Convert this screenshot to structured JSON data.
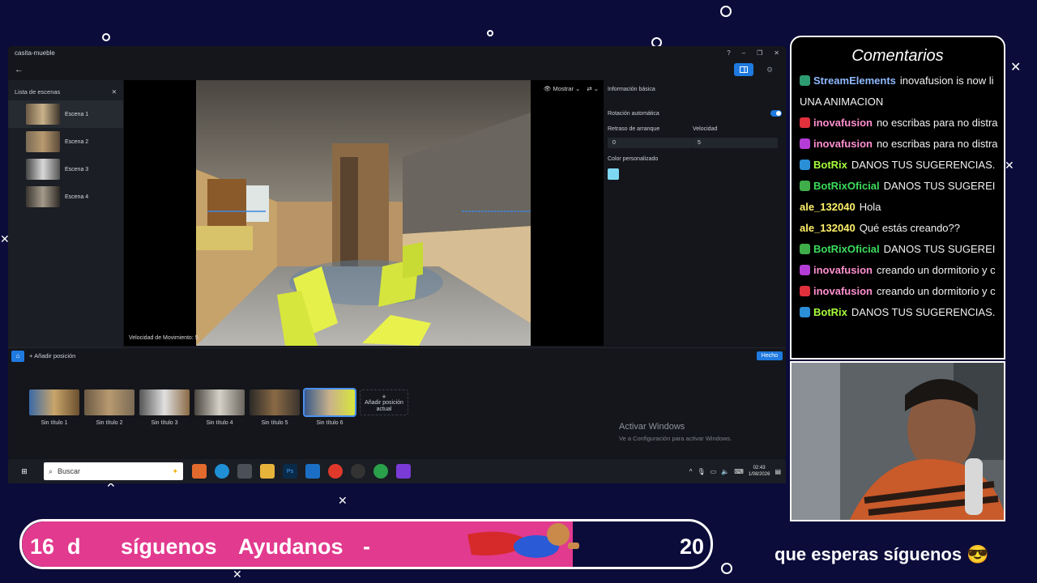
{
  "app": {
    "title": "casita-mueble",
    "window_controls": [
      "?",
      "–",
      "❐",
      "✕"
    ],
    "scene_panel": {
      "title": "Lista de escenas",
      "scenes": [
        {
          "label": "Escena 1"
        },
        {
          "label": "Escena 2"
        },
        {
          "label": "Escena 3"
        },
        {
          "label": "Escena 4"
        }
      ]
    },
    "viewport": {
      "speed_label": "Velocidad de Movimiento: 5",
      "show_label": "Mostrar"
    },
    "props": {
      "basic_info": "Información básica",
      "auto_rotation": "Rotación automática",
      "start_delay_label": "Retraso de arranque",
      "start_delay_value": "0",
      "speed_label": "Velocidad",
      "speed_value": "5",
      "custom_color": "Color personalizado",
      "color": "#7fd8f2"
    },
    "position_bar": {
      "add_label": "Añadir posición",
      "done_label": "Hecho"
    },
    "positions": [
      {
        "label": "Sin título 1"
      },
      {
        "label": "Sin título 2"
      },
      {
        "label": "Sin título 3"
      },
      {
        "label": "Sin título 4"
      },
      {
        "label": "Sin título 5"
      },
      {
        "label": "Sin título 6"
      }
    ],
    "add_current_label": "Añadir posición actual",
    "watermark": {
      "title": "Activar Windows",
      "subtitle": "Ve a Configuración para activar Windows."
    }
  },
  "taskbar": {
    "search_placeholder": "Buscar",
    "time": "02:43",
    "date": "1/08/2026"
  },
  "chat": {
    "title": "Comentarios",
    "messages": [
      {
        "user": "StreamElements",
        "text": "inovafusion is now li",
        "color": "#8fb9ff",
        "badge": "#2e9c72"
      },
      {
        "user": "",
        "text": "UNA ANIMACION",
        "color": "#ffffff",
        "badge": ""
      },
      {
        "user": "inovafusion",
        "text": "no escribas para no distra",
        "color": "#ff8fd0",
        "badge": "#e0303c"
      },
      {
        "user": "inovafusion",
        "text": "no escribas para no distra",
        "color": "#ff8fd0",
        "badge": "#b43cd6"
      },
      {
        "user": "BotRix",
        "text": "DANOS TUS SUGERENCIAS.",
        "color": "#a8ff3c",
        "badge": "#2a8fd6"
      },
      {
        "user": "BotRixOficial",
        "text": "DANOS TUS SUGEREI",
        "color": "#3cdc5c",
        "badge": "#3fae4a"
      },
      {
        "user": "ale_132040",
        "text": "Hola",
        "color": "#fff06a",
        "badge": ""
      },
      {
        "user": "ale_132040",
        "text": "Qué estás creando??",
        "color": "#fff06a",
        "badge": ""
      },
      {
        "user": "BotRixOficial",
        "text": "DANOS TUS SUGEREI",
        "color": "#3cdc5c",
        "badge": "#3fae4a"
      },
      {
        "user": "inovafusion",
        "text": "creando un dormitorio y c",
        "color": "#ff8fd0",
        "badge": "#b43cd6"
      },
      {
        "user": "inovafusion",
        "text": "creando un dormitorio y c",
        "color": "#ff8fd0",
        "badge": "#e0303c"
      },
      {
        "user": "BotRix",
        "text": "DANOS TUS SUGERENCIAS.",
        "color": "#a8ff3c",
        "badge": "#2a8fd6"
      }
    ]
  },
  "ticker": {
    "left_count": "16",
    "text_d": "d",
    "text_follow": "síguenos",
    "text_help": "Ayudanos",
    "text_dash": "-",
    "right_count": "20"
  },
  "follow_cta": "que esperas síguenos 😎"
}
